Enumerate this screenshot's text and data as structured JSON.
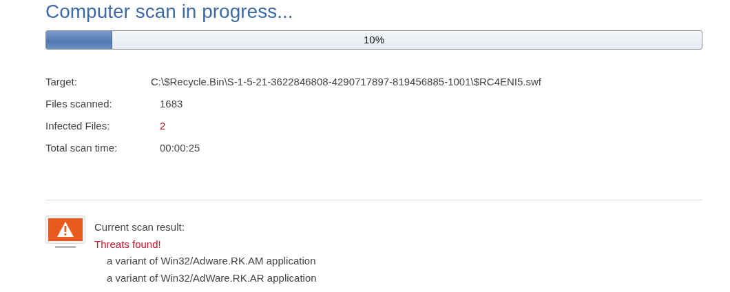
{
  "title": "Computer scan in progress...",
  "progress": {
    "level": 0.1,
    "reading": "10%"
  },
  "details": [
    {
      "label": "Target:",
      "value": "C:\\$Recycle.Bin\\S-1-5-21-3622846808-4290717897-819456885-1001\\$RC4ENI5.swf",
      "kind": "path"
    },
    {
      "label": "Files scanned:",
      "value": "1683",
      "kind": "plain"
    },
    {
      "label": "Infected Files:",
      "value": "2",
      "kind": "alert"
    },
    {
      "label": "Total scan time:",
      "value": "00:00:25",
      "kind": "plain"
    }
  ],
  "result": {
    "label": "Current scan result:",
    "status": "Threats found!",
    "threats": [
      "a variant of Win32/Adware.RK.AM application",
      "a variant of Win32/AdWare.RK.AR application"
    ]
  }
}
